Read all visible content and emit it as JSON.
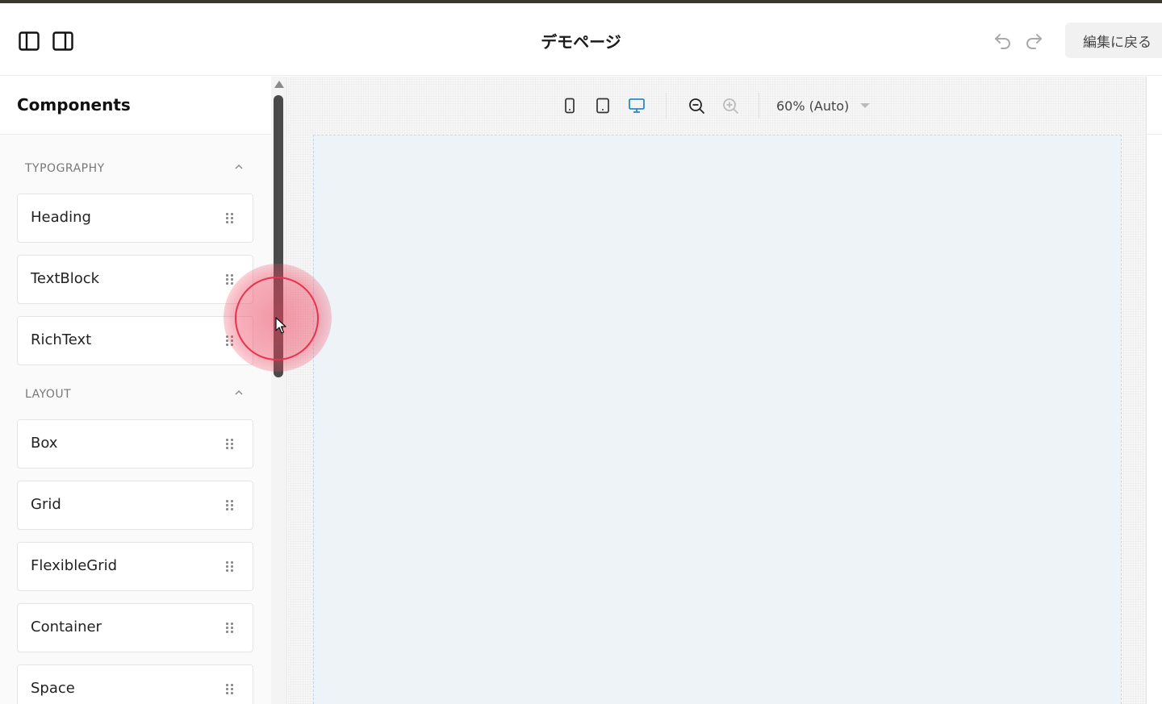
{
  "header": {
    "page_title": "デモページ",
    "back_label": "編集に戻る"
  },
  "sidebar": {
    "title": "Components",
    "sections": [
      {
        "label": "TYPOGRAPHY",
        "items": [
          "Heading",
          "TextBlock",
          "RichText"
        ]
      },
      {
        "label": "LAYOUT",
        "items": [
          "Box",
          "Grid",
          "FlexibleGrid",
          "Container",
          "Space"
        ]
      }
    ]
  },
  "canvas_toolbar": {
    "zoom_label": "60% (Auto)",
    "active_viewport": "desktop"
  },
  "icons": {
    "toggle_left_panel": "panel-left-icon",
    "toggle_right_panel": "panel-right-icon",
    "undo": "undo-icon",
    "redo": "redo-icon",
    "mobile": "mobile-icon",
    "tablet": "tablet-icon",
    "desktop": "desktop-icon",
    "zoom_out": "zoom-out-icon",
    "zoom_in": "zoom-in-icon",
    "grip": "drag-handle-icon",
    "collapse": "chevron-up-icon"
  },
  "colors": {
    "accent": "#2b8ac6",
    "click_indicator": "#e8324f",
    "canvas_bg": "#eef3f8"
  }
}
